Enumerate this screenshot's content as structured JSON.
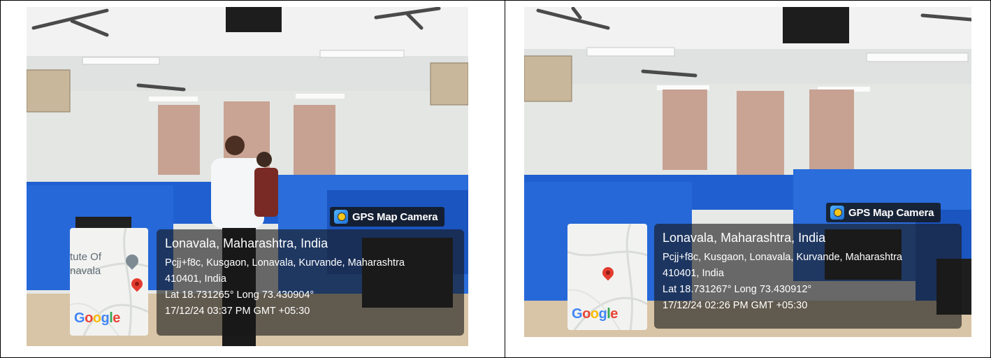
{
  "photos": [
    {
      "badge": {
        "label": "GPS Map Camera",
        "icon": "camera-icon"
      },
      "location": {
        "city": "Lonavala, Maharashtra, India",
        "address_line1": "Pcjj+f8c, Kusgaon, Lonavala, Kurvande, Maharashtra",
        "address_line2": "410401, India",
        "coords": "Lat 18.731265° Long 73.430904°",
        "timestamp": "17/12/24 03:37 PM GMT +05:30"
      },
      "map": {
        "place_label_1": "tute Of",
        "place_label_2": "navala",
        "brand": "Google"
      }
    },
    {
      "badge": {
        "label": "GPS Map Camera",
        "icon": "camera-icon"
      },
      "location": {
        "city": "Lonavala, Maharashtra, India",
        "address_line1": "Pcjj+f8c, Kusgaon, Lonavala, Kurvande, Maharashtra",
        "address_line2": "410401, India",
        "coords": "Lat 18.731267° Long 73.430912°",
        "timestamp": "17/12/24 02:26 PM GMT +05:30"
      },
      "map": {
        "brand": "Google"
      }
    }
  ],
  "colors": {
    "partition_blue": "#1f5fd0",
    "wall": "#e8eae8",
    "curtain": "#c9a08e",
    "desk": "#d9c3a3"
  }
}
